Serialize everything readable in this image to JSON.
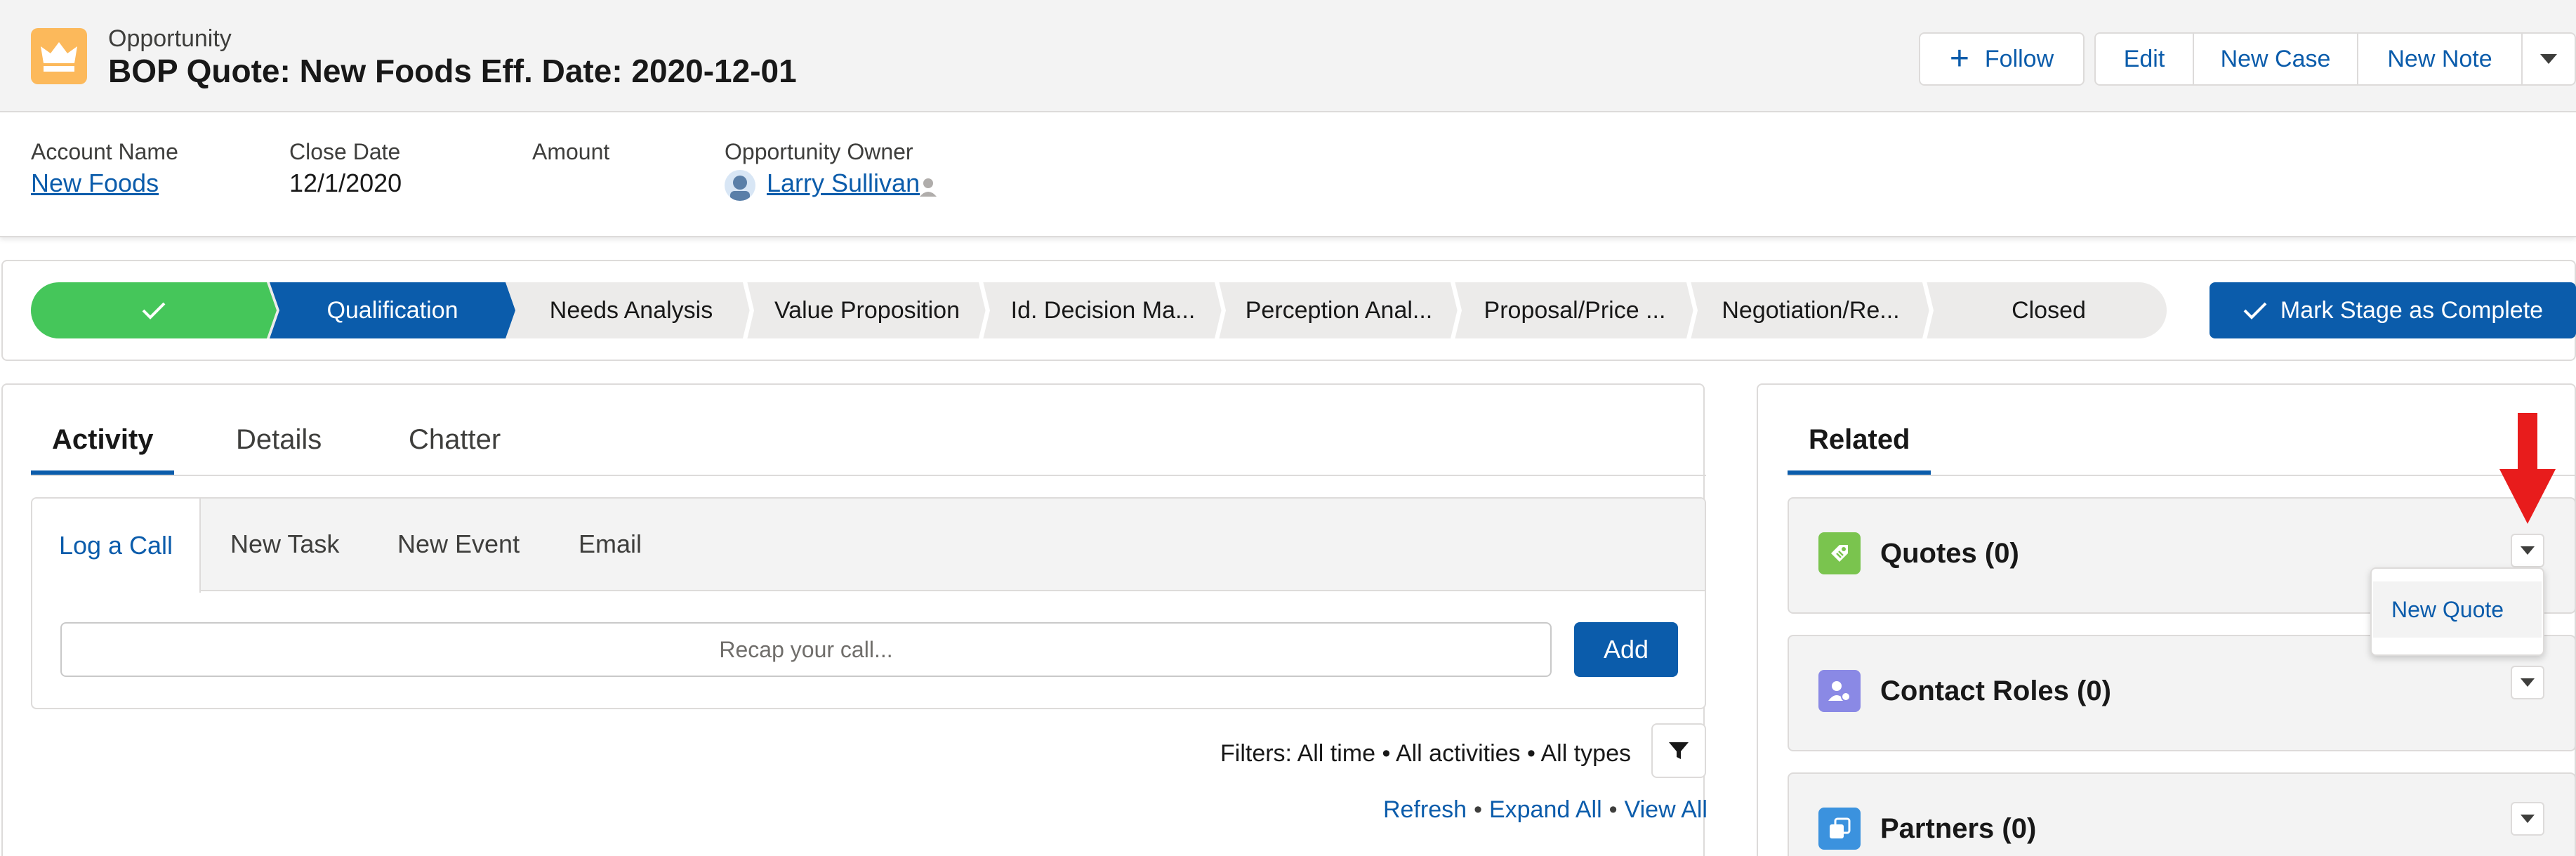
{
  "header": {
    "object_type": "Opportunity",
    "title": "BOP Quote: New Foods Eff. Date: 2020-12-01",
    "actions": {
      "follow": "Follow",
      "edit": "Edit",
      "new_case": "New Case",
      "new_note": "New Note"
    }
  },
  "highlights": {
    "account_name_label": "Account Name",
    "account_name_value": "New Foods",
    "close_date_label": "Close Date",
    "close_date_value": "12/1/2020",
    "amount_label": "Amount",
    "amount_value": "",
    "owner_label": "Opportunity Owner",
    "owner_value": "Larry Sullivan"
  },
  "path": {
    "steps": [
      {
        "label": "",
        "state": "complete"
      },
      {
        "label": "Qualification",
        "state": "current"
      },
      {
        "label": "Needs Analysis",
        "state": "incomplete"
      },
      {
        "label": "Value Proposition",
        "state": "incomplete"
      },
      {
        "label": "Id. Decision Ma...",
        "state": "incomplete"
      },
      {
        "label": "Perception Anal...",
        "state": "incomplete"
      },
      {
        "label": "Proposal/Price ...",
        "state": "incomplete"
      },
      {
        "label": "Negotiation/Re...",
        "state": "incomplete"
      },
      {
        "label": "Closed",
        "state": "incomplete"
      }
    ],
    "mark_complete_label": "Mark Stage as Complete"
  },
  "activity": {
    "tabs": [
      "Activity",
      "Details",
      "Chatter"
    ],
    "composer_tabs": [
      "Log a Call",
      "New Task",
      "New Event",
      "Email"
    ],
    "recap_placeholder": "Recap your call...",
    "add_label": "Add",
    "filters_text": "Filters: All time • All activities • All types",
    "links": {
      "refresh": "Refresh",
      "expand_all": "Expand All",
      "view_all": "View All"
    }
  },
  "related": {
    "tab_label": "Related",
    "lists": [
      {
        "title": "Quotes (0)",
        "icon": "quote-icon",
        "color": "#7ac44e"
      },
      {
        "title": "Contact Roles (0)",
        "icon": "contact-role-icon",
        "color": "#8a89e5"
      },
      {
        "title": "Partners (0)",
        "icon": "partner-icon",
        "color": "#3b92de"
      }
    ],
    "dropdown_item": "New Quote"
  },
  "colors": {
    "brand": "#0b5cab",
    "path_complete": "#45c65a",
    "object_icon": "#fcb95b",
    "annotation_arrow": "#e81c1c"
  }
}
